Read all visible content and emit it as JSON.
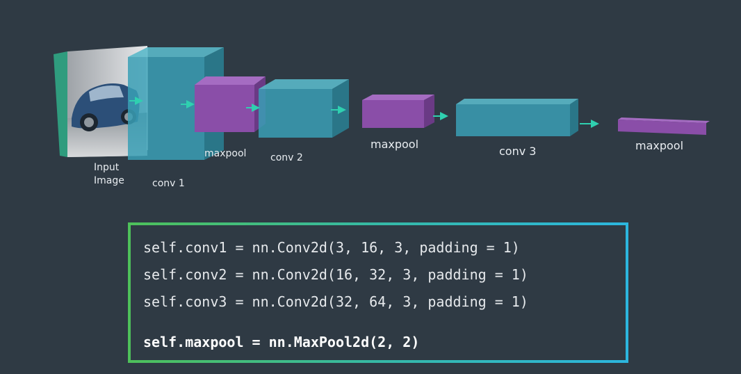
{
  "diagram": {
    "labels": {
      "input_image": "Input\nImage",
      "conv1": "conv 1",
      "maxpool1": "maxpool",
      "conv2": "conv 2",
      "maxpool2": "maxpool",
      "conv3": "conv 3",
      "maxpool3": "maxpool"
    },
    "colors": {
      "background": "#2f3a44",
      "conv": "#3a9fb5",
      "maxpool": "#8a4ea8",
      "arrow": "#2fd0b0",
      "input_frame": "#2f9c7e"
    },
    "input_image_icon": "car-photo-icon"
  },
  "code": {
    "lines": [
      "self.conv1 = nn.Conv2d(3, 16, 3, padding = 1)",
      "self.conv2 = nn.Conv2d(16, 32, 3, padding = 1)",
      "self.conv3 = nn.Conv2d(32, 64, 3, padding = 1)",
      "self.maxpool = nn.MaxPool2d(2, 2)"
    ],
    "border_colors": [
      "#4ec05a",
      "#2cb6df"
    ]
  }
}
